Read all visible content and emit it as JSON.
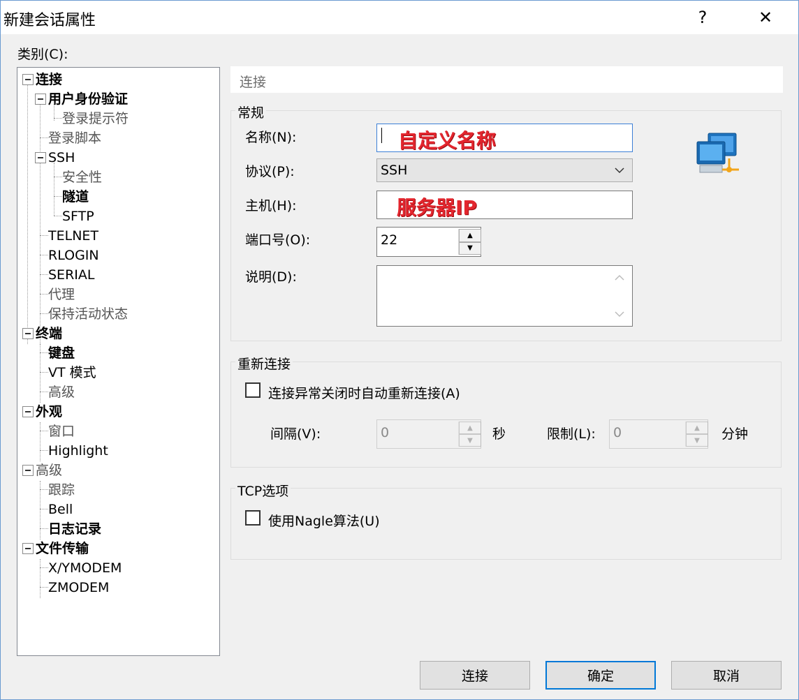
{
  "window": {
    "title": "新建会话属性",
    "help_glyph": "?",
    "close_glyph": "✕"
  },
  "category_label": "类别(C):",
  "tree": {
    "items": [
      {
        "label": "连接",
        "bold": true
      },
      {
        "label": "用户身份验证",
        "bold": true
      },
      {
        "label": "登录提示符"
      },
      {
        "label": "登录脚本"
      },
      {
        "label": "SSH"
      },
      {
        "label": "安全性"
      },
      {
        "label": "隧道",
        "bold": true
      },
      {
        "label": "SFTP"
      },
      {
        "label": "TELNET"
      },
      {
        "label": "RLOGIN"
      },
      {
        "label": "SERIAL"
      },
      {
        "label": "代理"
      },
      {
        "label": "保持活动状态"
      },
      {
        "label": "终端",
        "bold": true
      },
      {
        "label": "键盘",
        "bold": true
      },
      {
        "label": "VT 模式"
      },
      {
        "label": "高级"
      },
      {
        "label": "外观",
        "bold": true
      },
      {
        "label": "窗口"
      },
      {
        "label": "Highlight"
      },
      {
        "label": "高级"
      },
      {
        "label": "跟踪"
      },
      {
        "label": "Bell"
      },
      {
        "label": "日志记录",
        "bold": true
      },
      {
        "label": "文件传输",
        "bold": true
      },
      {
        "label": "X/YMODEM"
      },
      {
        "label": "ZMODEM"
      }
    ]
  },
  "panel": {
    "header": "连接"
  },
  "general": {
    "title": "常规",
    "name_label": "名称(N):",
    "name_value": "自定义名称",
    "protocol_label": "协议(P):",
    "protocol_value": "SSH",
    "host_label": "主机(H):",
    "host_value": "服务器IP",
    "port_label": "端口号(O):",
    "port_value": "22",
    "desc_label": "说明(D):",
    "desc_value": ""
  },
  "reconnect": {
    "title": "重新连接",
    "checkbox_label": "连接异常关闭时自动重新连接(A)",
    "interval_label": "间隔(V):",
    "interval_value": "0",
    "interval_unit": "秒",
    "limit_label": "限制(L):",
    "limit_value": "0",
    "limit_unit": "分钟"
  },
  "tcp": {
    "title": "TCP选项",
    "checkbox_label": "使用Nagle算法(U)"
  },
  "buttons": {
    "connect": "连接",
    "ok": "确定",
    "cancel": "取消"
  },
  "icon": {
    "name": "network-computers-icon",
    "colors": [
      "#1e73be",
      "#f2a51a"
    ]
  }
}
